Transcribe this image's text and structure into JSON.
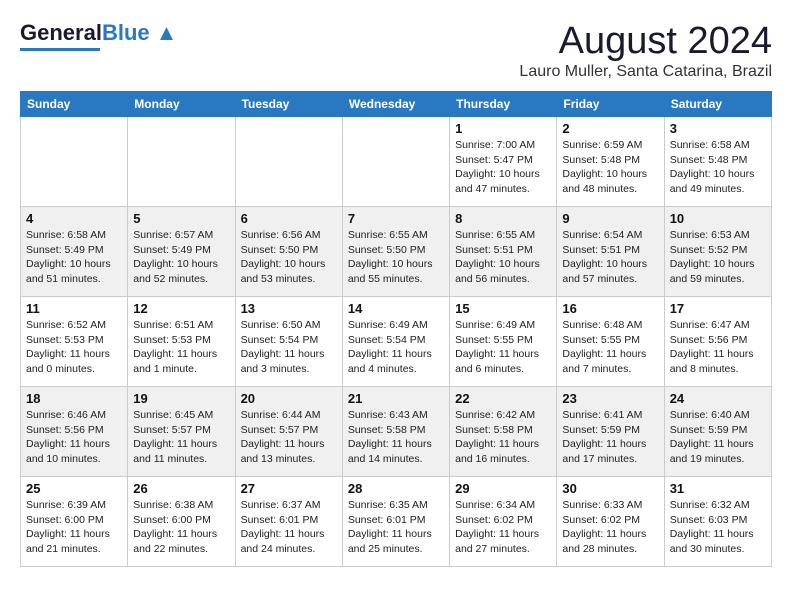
{
  "header": {
    "logo_line1": "General",
    "logo_line2": "Blue",
    "month_title": "August 2024",
    "subtitle": "Lauro Muller, Santa Catarina, Brazil"
  },
  "days_of_week": [
    "Sunday",
    "Monday",
    "Tuesday",
    "Wednesday",
    "Thursday",
    "Friday",
    "Saturday"
  ],
  "weeks": [
    [
      {
        "day": "",
        "info": ""
      },
      {
        "day": "",
        "info": ""
      },
      {
        "day": "",
        "info": ""
      },
      {
        "day": "",
        "info": ""
      },
      {
        "day": "1",
        "info": "Sunrise: 7:00 AM\nSunset: 5:47 PM\nDaylight: 10 hours\nand 47 minutes."
      },
      {
        "day": "2",
        "info": "Sunrise: 6:59 AM\nSunset: 5:48 PM\nDaylight: 10 hours\nand 48 minutes."
      },
      {
        "day": "3",
        "info": "Sunrise: 6:58 AM\nSunset: 5:48 PM\nDaylight: 10 hours\nand 49 minutes."
      }
    ],
    [
      {
        "day": "4",
        "info": "Sunrise: 6:58 AM\nSunset: 5:49 PM\nDaylight: 10 hours\nand 51 minutes."
      },
      {
        "day": "5",
        "info": "Sunrise: 6:57 AM\nSunset: 5:49 PM\nDaylight: 10 hours\nand 52 minutes."
      },
      {
        "day": "6",
        "info": "Sunrise: 6:56 AM\nSunset: 5:50 PM\nDaylight: 10 hours\nand 53 minutes."
      },
      {
        "day": "7",
        "info": "Sunrise: 6:55 AM\nSunset: 5:50 PM\nDaylight: 10 hours\nand 55 minutes."
      },
      {
        "day": "8",
        "info": "Sunrise: 6:55 AM\nSunset: 5:51 PM\nDaylight: 10 hours\nand 56 minutes."
      },
      {
        "day": "9",
        "info": "Sunrise: 6:54 AM\nSunset: 5:51 PM\nDaylight: 10 hours\nand 57 minutes."
      },
      {
        "day": "10",
        "info": "Sunrise: 6:53 AM\nSunset: 5:52 PM\nDaylight: 10 hours\nand 59 minutes."
      }
    ],
    [
      {
        "day": "11",
        "info": "Sunrise: 6:52 AM\nSunset: 5:53 PM\nDaylight: 11 hours\nand 0 minutes."
      },
      {
        "day": "12",
        "info": "Sunrise: 6:51 AM\nSunset: 5:53 PM\nDaylight: 11 hours\nand 1 minute."
      },
      {
        "day": "13",
        "info": "Sunrise: 6:50 AM\nSunset: 5:54 PM\nDaylight: 11 hours\nand 3 minutes."
      },
      {
        "day": "14",
        "info": "Sunrise: 6:49 AM\nSunset: 5:54 PM\nDaylight: 11 hours\nand 4 minutes."
      },
      {
        "day": "15",
        "info": "Sunrise: 6:49 AM\nSunset: 5:55 PM\nDaylight: 11 hours\nand 6 minutes."
      },
      {
        "day": "16",
        "info": "Sunrise: 6:48 AM\nSunset: 5:55 PM\nDaylight: 11 hours\nand 7 minutes."
      },
      {
        "day": "17",
        "info": "Sunrise: 6:47 AM\nSunset: 5:56 PM\nDaylight: 11 hours\nand 8 minutes."
      }
    ],
    [
      {
        "day": "18",
        "info": "Sunrise: 6:46 AM\nSunset: 5:56 PM\nDaylight: 11 hours\nand 10 minutes."
      },
      {
        "day": "19",
        "info": "Sunrise: 6:45 AM\nSunset: 5:57 PM\nDaylight: 11 hours\nand 11 minutes."
      },
      {
        "day": "20",
        "info": "Sunrise: 6:44 AM\nSunset: 5:57 PM\nDaylight: 11 hours\nand 13 minutes."
      },
      {
        "day": "21",
        "info": "Sunrise: 6:43 AM\nSunset: 5:58 PM\nDaylight: 11 hours\nand 14 minutes."
      },
      {
        "day": "22",
        "info": "Sunrise: 6:42 AM\nSunset: 5:58 PM\nDaylight: 11 hours\nand 16 minutes."
      },
      {
        "day": "23",
        "info": "Sunrise: 6:41 AM\nSunset: 5:59 PM\nDaylight: 11 hours\nand 17 minutes."
      },
      {
        "day": "24",
        "info": "Sunrise: 6:40 AM\nSunset: 5:59 PM\nDaylight: 11 hours\nand 19 minutes."
      }
    ],
    [
      {
        "day": "25",
        "info": "Sunrise: 6:39 AM\nSunset: 6:00 PM\nDaylight: 11 hours\nand 21 minutes."
      },
      {
        "day": "26",
        "info": "Sunrise: 6:38 AM\nSunset: 6:00 PM\nDaylight: 11 hours\nand 22 minutes."
      },
      {
        "day": "27",
        "info": "Sunrise: 6:37 AM\nSunset: 6:01 PM\nDaylight: 11 hours\nand 24 minutes."
      },
      {
        "day": "28",
        "info": "Sunrise: 6:35 AM\nSunset: 6:01 PM\nDaylight: 11 hours\nand 25 minutes."
      },
      {
        "day": "29",
        "info": "Sunrise: 6:34 AM\nSunset: 6:02 PM\nDaylight: 11 hours\nand 27 minutes."
      },
      {
        "day": "30",
        "info": "Sunrise: 6:33 AM\nSunset: 6:02 PM\nDaylight: 11 hours\nand 28 minutes."
      },
      {
        "day": "31",
        "info": "Sunrise: 6:32 AM\nSunset: 6:03 PM\nDaylight: 11 hours\nand 30 minutes."
      }
    ]
  ]
}
